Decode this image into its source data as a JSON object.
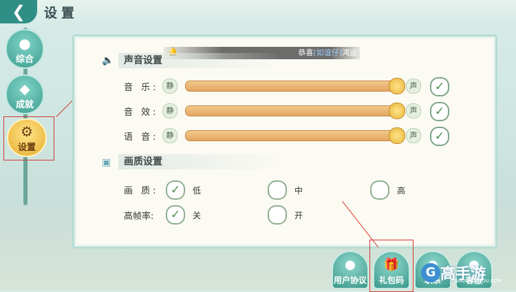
{
  "header": {
    "back_icon": "back-arrow-icon",
    "title": "设置"
  },
  "sidebar": {
    "items": [
      {
        "label": "综合",
        "icon": "person-icon"
      },
      {
        "label": "成就",
        "icon": "badge-icon"
      },
      {
        "label": "设置",
        "icon": "gear-icon",
        "selected": true
      }
    ]
  },
  "banner": {
    "prefix": "恭喜",
    "name": "[如谊仔]",
    "suffix": "鸿运"
  },
  "sound": {
    "title": "声音设置",
    "rows": [
      {
        "label": "音 乐:",
        "quiet": "静",
        "loud": "声",
        "level": 0.98,
        "enabled": true
      },
      {
        "label": "音 效:",
        "quiet": "静",
        "loud": "声",
        "level": 0.98,
        "enabled": true
      },
      {
        "label": "语 音:",
        "quiet": "静",
        "loud": "声",
        "level": 0.98,
        "enabled": true
      }
    ]
  },
  "graphics": {
    "title": "画质设置",
    "quality": {
      "label": "画 质:",
      "options": [
        "低",
        "中",
        "高"
      ],
      "selected": "低"
    },
    "highfps": {
      "label": "高帧率:",
      "options": [
        "关",
        "开"
      ],
      "selected": "关"
    }
  },
  "footer": {
    "buttons": [
      "用户协议",
      "礼包码",
      "联系",
      "客服"
    ]
  },
  "watermark": {
    "text": "高手游",
    "sub": "GAOSHOUYOU.COM",
    "logo": "G"
  },
  "colors": {
    "accent": "#3e9e91",
    "selected": "#e5ac2c",
    "annotation": "#d23a32"
  }
}
